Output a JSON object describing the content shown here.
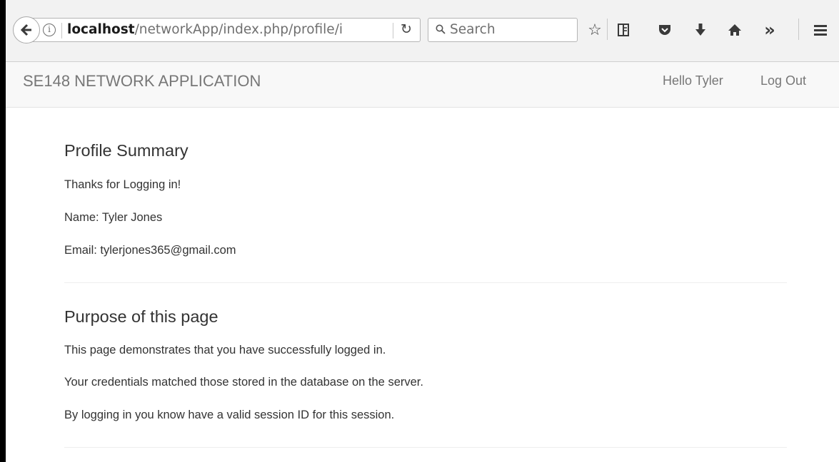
{
  "browser": {
    "url_host": "localhost",
    "url_path": "/networkApp/index.php/profile/i",
    "search_placeholder": "Search",
    "icons": [
      "back-arrow-icon",
      "info-icon",
      "reload-icon",
      "search-icon",
      "bookmark-star-icon",
      "reading-list-icon",
      "pocket-icon",
      "download-icon",
      "home-icon",
      "overflow-chevron-icon",
      "hamburger-menu-icon"
    ]
  },
  "navbar": {
    "brand": "SE148 NETWORK APPLICATION",
    "greeting": "Hello Tyler",
    "logout": "Log Out"
  },
  "profile": {
    "heading": "Profile Summary",
    "thanks": "Thanks for Logging in!",
    "name": "Name: Tyler Jones",
    "email": "Email: tylerjones365@gmail.com"
  },
  "purpose": {
    "heading": "Purpose of this page",
    "line1": "This page demonstrates that you have successfully logged in.",
    "line2": "Your credentials matched those stored in the database on the server.",
    "line3": "By logging in you know have a valid session ID for this session."
  }
}
